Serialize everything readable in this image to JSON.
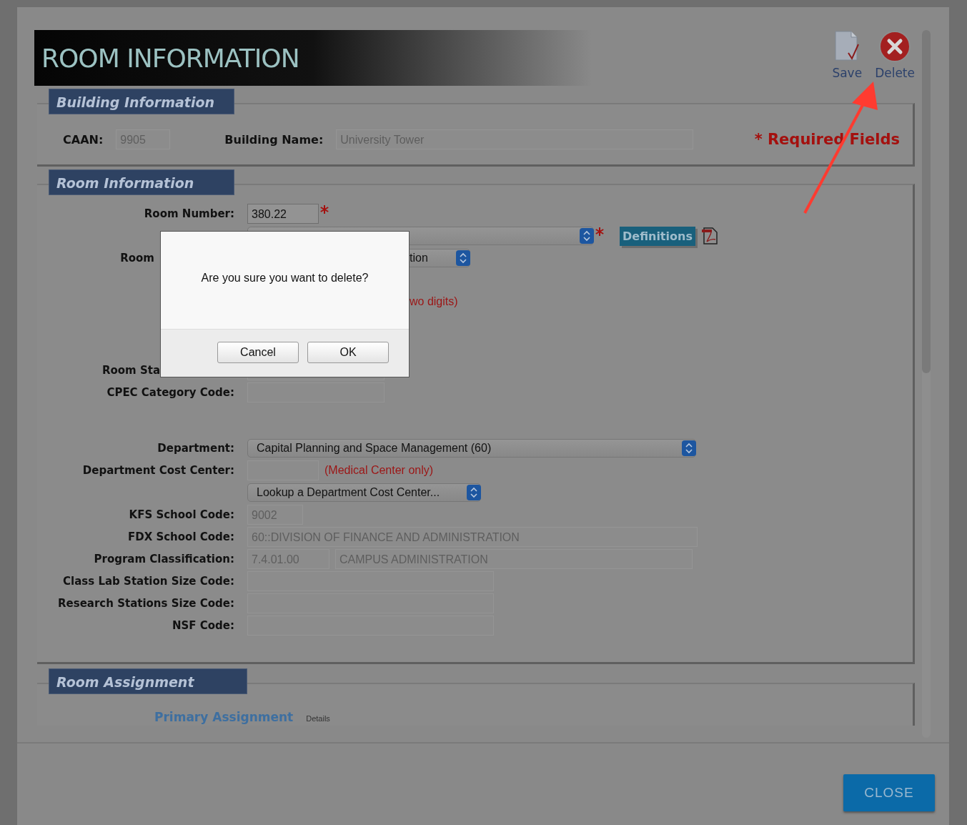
{
  "header": {
    "title": "ROOM INFORMATION",
    "actions": [
      {
        "kind": "save",
        "label": "Save"
      },
      {
        "kind": "delete",
        "label": "Delete"
      }
    ]
  },
  "building_section": {
    "title": "Building Information",
    "fields": [
      {
        "label": "CAAN:",
        "value": "9905"
      },
      {
        "label": "Building Name:",
        "value": "University Tower"
      }
    ],
    "required_note": "* Required Fields"
  },
  "room_section": {
    "title": "Room Information",
    "rows": [
      {
        "label": "Room Number:",
        "required": true,
        "fields": [
          {
            "kind": "input",
            "value": "380.22",
            "disabled": false
          }
        ]
      },
      {
        "required": true,
        "button": "Definitions",
        "fields": [
          {
            "kind": "select",
            "disabled": false
          }
        ]
      },
      {
        "label": "Room",
        "required": false,
        "fields": [
          {
            "kind": "select",
            "value": "tion",
            "disabled": false
          }
        ]
      },
      {
        "required": false,
        "note": "wo digits)"
      },
      {
        "label": "Room Sta",
        "required": false,
        "fields": [
          {
            "kind": "input",
            "disabled": true
          }
        ]
      },
      {
        "label": "CPEC Category Code:",
        "required": false,
        "fields": [
          {
            "kind": "input",
            "disabled": true
          }
        ]
      },
      {
        "label": "Department:",
        "required": false,
        "fields": [
          {
            "kind": "select",
            "value": "Capital Planning and Space Management (60)",
            "disabled": false
          }
        ]
      },
      {
        "label": "Department Cost Center:",
        "required": false,
        "note": "(Medical Center only)",
        "fields": [
          {
            "kind": "input",
            "disabled": true
          }
        ]
      },
      {
        "required": false,
        "fields": [
          {
            "kind": "select",
            "value": "Lookup a Department Cost Center...",
            "disabled": false
          }
        ]
      },
      {
        "label": "KFS School Code:",
        "required": false,
        "fields": [
          {
            "kind": "input",
            "value": "9002",
            "disabled": true
          }
        ]
      },
      {
        "label": "FDX School Code:",
        "required": false,
        "fields": [
          {
            "kind": "input",
            "value": "60::DIVISION OF FINANCE AND ADMINISTRATION",
            "disabled": true
          }
        ]
      },
      {
        "label": "Program Classification:",
        "required": false,
        "fields": [
          {
            "kind": "input",
            "value": "7.4.01.00",
            "disabled": true
          },
          {
            "kind": "input",
            "value": "CAMPUS ADMINISTRATION",
            "disabled": true
          }
        ]
      },
      {
        "label": "Class Lab Station Size Code:",
        "required": false,
        "fields": [
          {
            "kind": "input",
            "disabled": true
          }
        ]
      },
      {
        "label": "Research Stations Size Code:",
        "required": false,
        "fields": [
          {
            "kind": "input",
            "disabled": true
          }
        ]
      },
      {
        "label": "NSF Code:",
        "required": false,
        "fields": [
          {
            "kind": "input",
            "disabled": true
          }
        ]
      }
    ]
  },
  "assignment_section": {
    "title": "Room Assignment",
    "link": "Primary Assignment",
    "link_note": "Details"
  },
  "dialog": {
    "message": "Are you sure you want to delete?",
    "buttons": [
      "Cancel",
      "OK"
    ]
  },
  "close_button": "CLOSE"
}
